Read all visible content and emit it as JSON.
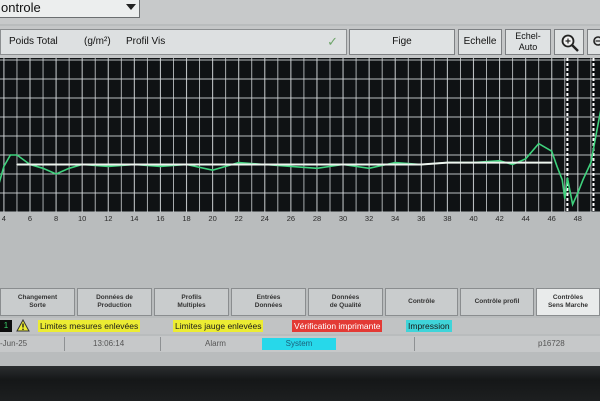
{
  "dropdown": {
    "value": "ontrole"
  },
  "toolbar": {
    "param": "Poids Total",
    "unit": "(g/m²)",
    "profile": "Profil Vis",
    "fige": "Fige",
    "echelle": "Echelle",
    "echel_auto_1": "Echel-",
    "echel_auto_2": "Auto"
  },
  "chart_data": {
    "type": "line",
    "x_ticks": [
      4,
      6,
      8,
      10,
      12,
      14,
      16,
      18,
      20,
      22,
      24,
      26,
      28,
      30,
      32,
      34,
      36,
      38,
      40,
      42,
      44,
      46,
      48
    ],
    "series": [
      {
        "color": "#3fd27d",
        "x": [
          3.0,
          4.0,
          4.5,
          5.0,
          6.0,
          7.0,
          8.0,
          9.0,
          10.0,
          12.0,
          14.0,
          16.0,
          18.0,
          20.0,
          22.0,
          24.0,
          26.0,
          28.0,
          30.0,
          32.0,
          34.0,
          36.0,
          38.0,
          40.0,
          42.0,
          43.0,
          44.0,
          45.0,
          46.0,
          46.4,
          46.8,
          47.0,
          47.2,
          47.6,
          48.0,
          48.4,
          49.0,
          49.6,
          50.0
        ],
        "y": [
          0.0,
          2.4,
          3.0,
          3.0,
          2.5,
          2.3,
          2.0,
          2.3,
          2.5,
          2.4,
          2.5,
          2.4,
          2.5,
          2.2,
          2.6,
          2.5,
          2.4,
          2.3,
          2.5,
          2.3,
          2.6,
          2.5,
          2.6,
          2.6,
          2.7,
          2.5,
          2.8,
          3.6,
          3.2,
          2.4,
          1.7,
          0.7,
          1.8,
          0.4,
          1.0,
          1.7,
          2.6,
          4.8,
          6.2
        ]
      },
      {
        "color": "#eef5ef",
        "x": [
          5,
          8,
          10,
          12,
          14,
          16,
          18,
          20,
          22,
          24,
          26,
          28,
          30,
          32,
          34,
          36,
          38,
          40,
          42,
          44,
          46
        ],
        "y": [
          2.5,
          2.5,
          2.5,
          2.5,
          2.5,
          2.5,
          2.5,
          2.5,
          2.5,
          2.5,
          2.5,
          2.5,
          2.5,
          2.5,
          2.5,
          2.5,
          2.6,
          2.6,
          2.6,
          2.6,
          2.6
        ]
      }
    ],
    "grid": true,
    "ylim": [
      0,
      8
    ],
    "xlim": [
      3.7,
      49.7
    ],
    "limit_markers_x": [
      47.2,
      49.2
    ]
  },
  "tabs": [
    {
      "line1": "Changement",
      "line2": "Sorte",
      "active": false
    },
    {
      "line1": "Données de",
      "line2": "Production",
      "active": false
    },
    {
      "line1": "Profils",
      "line2": "Multiples",
      "active": false
    },
    {
      "line1": "Entrées",
      "line2": "Données",
      "active": false
    },
    {
      "line1": "Données",
      "line2": "de Qualité",
      "active": false
    },
    {
      "line1": "Contrôle",
      "line2": "",
      "active": false
    },
    {
      "line1": "Contrôle profil",
      "line2": "",
      "active": false
    },
    {
      "line1": "Contrôles",
      "line2": "Sens Marche",
      "active": true
    }
  ],
  "alarms": {
    "count": "1",
    "items": [
      {
        "text": "Limites mesures enlevées",
        "bg": "#ecec33",
        "fg": "#1a1a1a"
      },
      {
        "text": "Limites jauge enlevées",
        "bg": "#ecec33",
        "fg": "#1a1a1a"
      },
      {
        "text": "Vérification imprimante",
        "bg": "#e33a35",
        "fg": "#ffffff"
      },
      {
        "text": "Impression",
        "bg": "#3fd4d9",
        "fg": "#1a1a1a"
      }
    ]
  },
  "status": {
    "date": "-Jun-25",
    "time": "13:06:14",
    "alarm": "Alarm",
    "system": "System",
    "page": "p16728"
  },
  "colors": {
    "warning_yellow": "#ecec33",
    "system_cyan": "#27d8ea"
  }
}
